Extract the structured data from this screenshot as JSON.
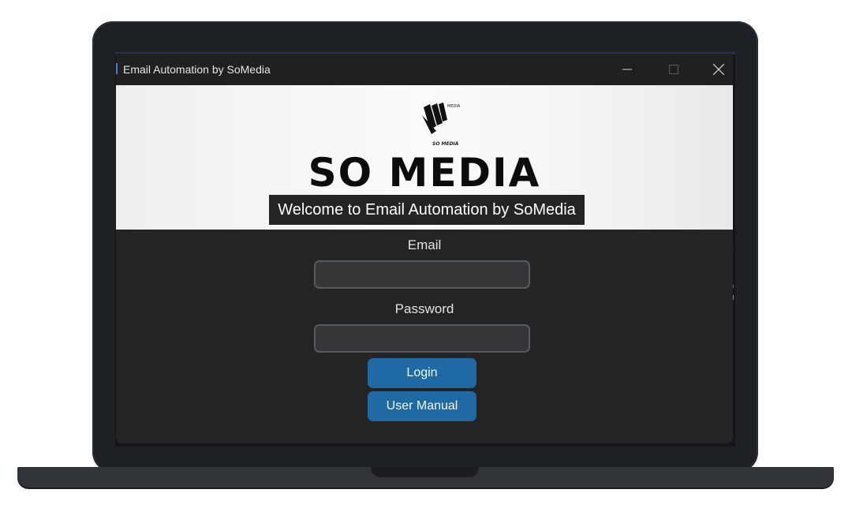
{
  "window": {
    "title": "Email Automation by SoMedia",
    "controls": {
      "minimize": "—",
      "maximize": "☐",
      "close": "✕"
    }
  },
  "banner": {
    "logo_caption": "SO MEDIA",
    "logo_tag": "MEDIA",
    "brand_name": "SO MEDIA",
    "welcome_text": "Welcome to Email Automation by SoMedia"
  },
  "form": {
    "email_label": "Email",
    "email_value": "",
    "password_label": "Password",
    "password_value": "",
    "login_label": "Login",
    "manual_label": "User Manual"
  },
  "background_edge_text": [
    "s",
    "r",
    "a",
    "g",
    "r"
  ],
  "colors": {
    "window_bg": "#242424",
    "titlebar_bg": "#202020",
    "button": "#1f6aa5",
    "input_bg": "#343638",
    "input_border": "#565b5e",
    "laptop_frame": "#1d2024"
  },
  "icons": {
    "minimize": "minimize-icon",
    "maximize": "maximize-icon",
    "close": "close-icon",
    "logo": "somedia-logo"
  }
}
